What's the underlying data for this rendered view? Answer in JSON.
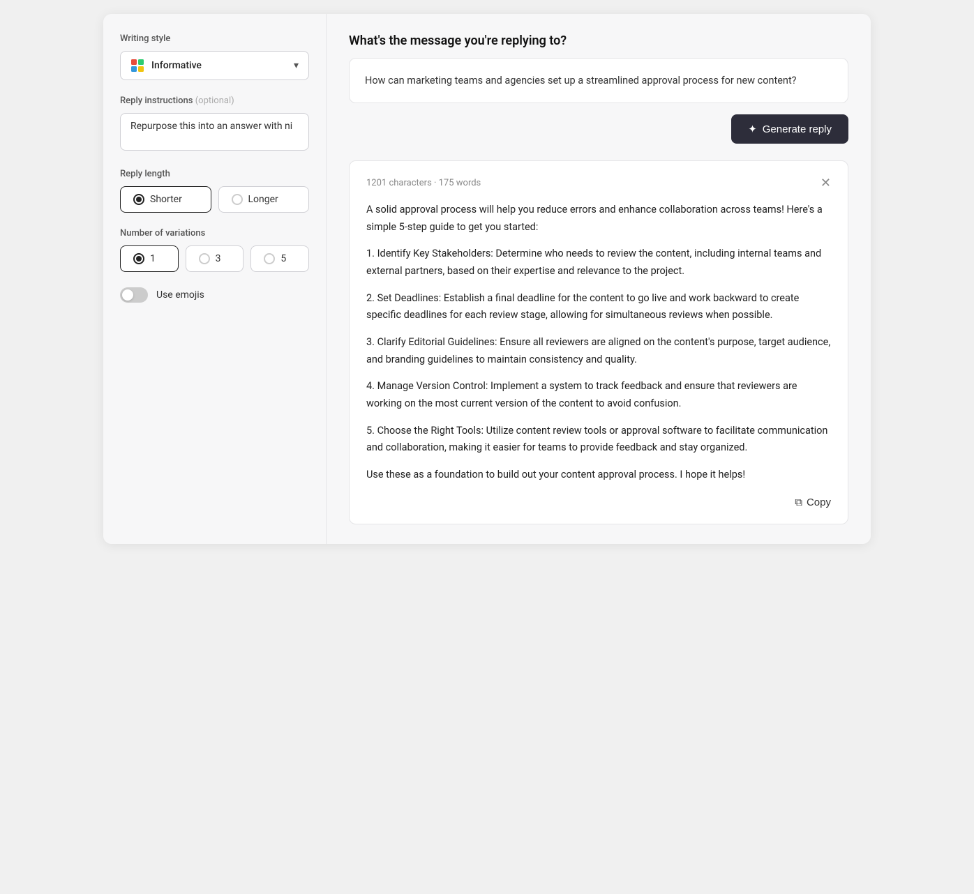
{
  "left": {
    "writing_style_label": "Writing style",
    "style_selected": "Informative",
    "reply_instructions_label": "Reply instructions",
    "reply_instructions_optional": "(optional)",
    "reply_instructions_value": "Repurpose this into an answer with ni",
    "reply_length_label": "Reply length",
    "length_options": [
      {
        "label": "Shorter",
        "selected": true
      },
      {
        "label": "Longer",
        "selected": false
      }
    ],
    "variations_label": "Number of variations",
    "variation_options": [
      {
        "label": "1",
        "selected": true
      },
      {
        "label": "3",
        "selected": false
      },
      {
        "label": "5",
        "selected": false
      }
    ],
    "use_emojis_label": "Use emojis",
    "emojis_enabled": false
  },
  "right": {
    "question_title": "What's the message you're replying to?",
    "message_text": "How can marketing teams and agencies set up a streamlined approval process for new content?",
    "generate_btn_label": "Generate reply",
    "result": {
      "stats": "1201 characters · 175 words",
      "paragraphs": [
        "A solid approval process will help you reduce errors and enhance collaboration across teams! Here's a simple 5-step guide to get you started:",
        "1. Identify Key Stakeholders: Determine who needs to review the content, including internal teams and external partners, based on their expertise and relevance to the project.",
        "2. Set Deadlines: Establish a final deadline for the content to go live and work backward to create specific deadlines for each review stage, allowing for simultaneous reviews when possible.",
        "3. Clarify Editorial Guidelines: Ensure all reviewers are aligned on the content's purpose, target audience, and branding guidelines to maintain consistency and quality.",
        "4. Manage Version Control: Implement a system to track feedback and ensure that reviewers are working on the most current version of the content to avoid confusion.",
        "5. Choose the Right Tools: Utilize content review tools or approval software to facilitate communication and collaboration, making it easier for teams to provide feedback and stay organized.",
        "Use these as a foundation to build out your content approval process. I hope it helps!"
      ],
      "copy_btn_label": "Copy"
    }
  },
  "icons": {
    "sparkle": "✦",
    "copy": "⧉",
    "chevron_down": "▾",
    "close": "✕"
  }
}
